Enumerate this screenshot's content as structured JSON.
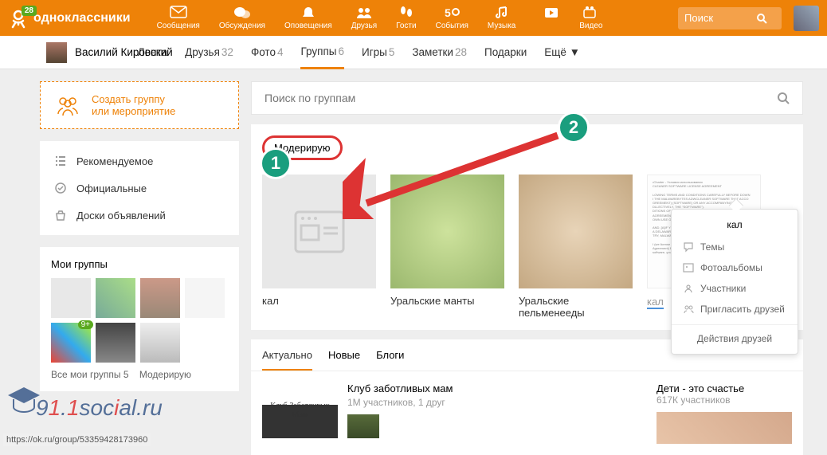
{
  "header": {
    "site_name": "одноклассники",
    "badge": "28",
    "nav": [
      {
        "label": "Сообщения"
      },
      {
        "label": "Обсуждения"
      },
      {
        "label": "Оповещения"
      },
      {
        "label": "Друзья"
      },
      {
        "label": "Гости"
      },
      {
        "label": "События"
      },
      {
        "label": "Музыка"
      },
      {
        "label": "Видео"
      }
    ],
    "search_placeholder": "Поиск"
  },
  "user": {
    "name": "Василий Кировский"
  },
  "tabs": [
    {
      "label": "Лента",
      "count": ""
    },
    {
      "label": "Друзья",
      "count": "32"
    },
    {
      "label": "Фото",
      "count": "4"
    },
    {
      "label": "Группы",
      "count": "6",
      "active": true
    },
    {
      "label": "Игры",
      "count": "5"
    },
    {
      "label": "Заметки",
      "count": "28"
    },
    {
      "label": "Подарки",
      "count": ""
    },
    {
      "label": "Ещё ▼",
      "count": ""
    }
  ],
  "sidebar": {
    "create": {
      "line1": "Создать группу",
      "line2": "или мероприятие"
    },
    "menu": [
      {
        "label": "Рекомендуемое"
      },
      {
        "label": "Официальные"
      },
      {
        "label": "Доски объявлений"
      }
    ],
    "my_groups_title": "Мои группы",
    "thumb_badge": "9+",
    "bottom_tabs": {
      "all": "Все мои группы 5",
      "mod": "Модерирую"
    }
  },
  "main": {
    "search_placeholder": "Поиск по группам",
    "mod_tab": "Модерирую",
    "cards": [
      {
        "title": "кал"
      },
      {
        "title": "Уральские манты"
      },
      {
        "title": "Уральские пельменееды"
      },
      {
        "title": "кал"
      }
    ],
    "actual_tabs": [
      "Актуально",
      "Новые",
      "Блоги"
    ],
    "actual_cards": [
      {
        "title": "Клуб заботливых мам",
        "meta": "1М участников, 1 друг",
        "logo": "Клуб Заботливых Мам"
      },
      {
        "title": "Дети - это счастье",
        "meta": "617К участников"
      }
    ],
    "popup": {
      "title": "кал",
      "items": [
        "Темы",
        "Фотоальбомы",
        "Участники",
        "Пригласить друзей"
      ],
      "footer": "Действия друзей"
    }
  },
  "annotations": {
    "step1": "1",
    "step2": "2"
  },
  "watermark": "911social.ru",
  "status_bar": "https://ok.ru/group/53359428173960"
}
